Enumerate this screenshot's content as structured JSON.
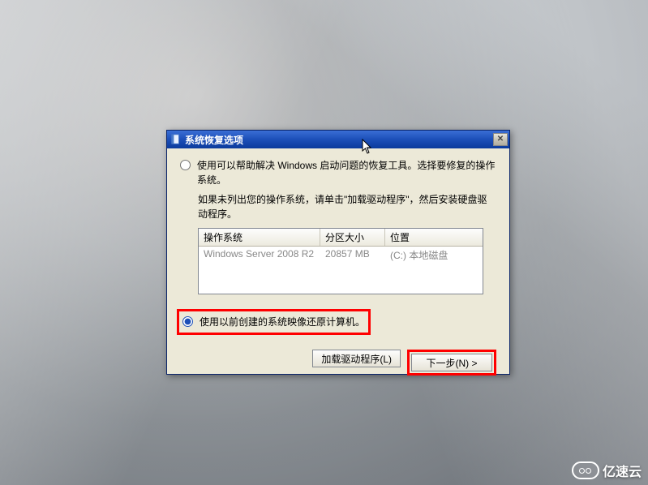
{
  "watermark": {
    "text": "亿速云"
  },
  "window": {
    "title": "系统恢复选项",
    "option1": {
      "label": "使用可以帮助解决 Windows 启动问题的恢复工具。选择要修复的操作系统。",
      "hint": "如果未列出您的操作系统，请单击\"加载驱动程序\"，然后安装硬盘驱动程序。"
    },
    "table": {
      "headers": {
        "os": "操作系统",
        "size": "分区大小",
        "loc": "位置"
      },
      "rows": [
        {
          "os": "Windows Server 2008 R2",
          "size": "20857 MB",
          "loc": "(C:) 本地磁盘"
        }
      ]
    },
    "option2": {
      "label": "使用以前创建的系统映像还原计算机。"
    },
    "buttons": {
      "load": "加载驱动程序(L)",
      "next": "下一步(N) >"
    }
  }
}
